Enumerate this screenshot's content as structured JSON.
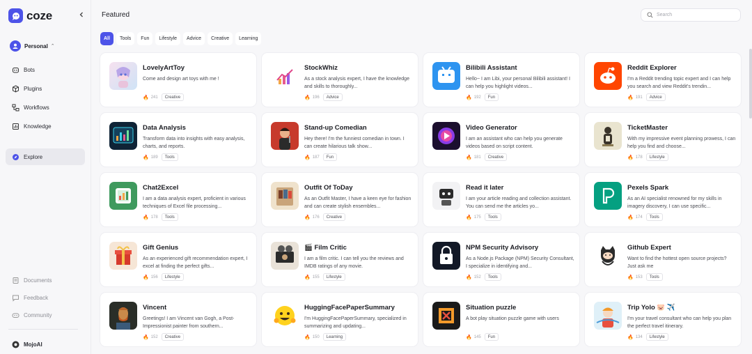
{
  "app": {
    "name": "coze"
  },
  "sidebar": {
    "workspace": "Personal",
    "nav": [
      {
        "label": "Bots",
        "icon": "bot-icon"
      },
      {
        "label": "Plugins",
        "icon": "plugin-icon"
      },
      {
        "label": "Workflows",
        "icon": "workflow-icon"
      },
      {
        "label": "Knowledge",
        "icon": "knowledge-icon"
      },
      {
        "label": "Explore",
        "icon": "explore-icon"
      }
    ],
    "bottom": [
      {
        "label": "Documents",
        "icon": "document-icon"
      },
      {
        "label": "Feedback",
        "icon": "feedback-icon"
      },
      {
        "label": "Community",
        "icon": "community-icon"
      }
    ],
    "user": "MojoAI"
  },
  "header": {
    "title": "Featured",
    "search_placeholder": "Search"
  },
  "filters": [
    "All",
    "Tools",
    "Fun",
    "Lifestyle",
    "Advice",
    "Creative",
    "Learning"
  ],
  "bots": [
    {
      "name": "LovelyArtToy",
      "desc": "Come and design art toys with me !",
      "count": "241",
      "tag": "Creative"
    },
    {
      "name": "StockWhiz",
      "desc": "As a stock analysis expert, I have the knowledge and skills to thoroughly...",
      "count": "196",
      "tag": "Advice"
    },
    {
      "name": "Bilibili Assistant",
      "desc": "Hello~ I am Libi, your personal Bilibili assistant! I can help you highlight videos...",
      "count": "192",
      "tag": "Fun"
    },
    {
      "name": "Reddit Explorer",
      "desc": "I'm a Reddit trending topic expert and I can help you search and view Reddit's trendin...",
      "count": "191",
      "tag": "Advice"
    },
    {
      "name": "Data Analysis",
      "desc": "Transform data into insights with easy analysis, charts, and reports.",
      "count": "189",
      "tag": "Tools"
    },
    {
      "name": "Stand-up Comedian",
      "desc": "Hey there! I'm the funniest comedian in town. I can create hilarious talk show...",
      "count": "187",
      "tag": "Fun"
    },
    {
      "name": "Video Generator",
      "desc": "I am an assistant who can help you generate videos based on script content.",
      "count": "181",
      "tag": "Creative"
    },
    {
      "name": "TicketMaster",
      "desc": "With my impressive event planning prowess, I can help you find and choose...",
      "count": "178",
      "tag": "Lifestyle"
    },
    {
      "name": "Chat2Excel",
      "desc": "I am a data analysis expert, proficient in various techniques of Excel file processing...",
      "count": "178",
      "tag": "Tools"
    },
    {
      "name": "Outfit Of ToDay",
      "desc": "As an Outfit Master, I have a keen eye for fashion and can create stylish ensembles...",
      "count": "176",
      "tag": "Creative"
    },
    {
      "name": "Read it later",
      "desc": "I am your article reading and collection assistant. You can send me the articles yo...",
      "count": "175",
      "tag": "Tools"
    },
    {
      "name": "Pexels Spark",
      "desc": "As an AI specialist renowned for my skills in imagery discovery, I can use specific...",
      "count": "174",
      "tag": "Tools"
    },
    {
      "name": "Gift Genius",
      "desc": "As an experienced gift recommendation expert, I excel at finding the perfect gifts...",
      "count": "156",
      "tag": "Lifestyle"
    },
    {
      "name": "🎬 Film Critic",
      "desc": "I am a film critic. I can tell you the reviews and IMDB ratings of any movie.",
      "count": "155",
      "tag": "Lifestyle"
    },
    {
      "name": "NPM Security Advisory",
      "desc": "As a Node.js Package (NPM) Security Consultant, I specialize in identifying and...",
      "count": "152",
      "tag": "Tools"
    },
    {
      "name": "Github Expert",
      "desc": "Want to find the hottest open source projects? Just ask me",
      "count": "153",
      "tag": "Tools"
    },
    {
      "name": "Vincent",
      "desc": "Greetings! I am Vincent van Gogh, a Post-Impressionist painter from southern...",
      "count": "152",
      "tag": "Creative"
    },
    {
      "name": "HuggingFacePaperSummary",
      "desc": "I'm HuggingFacePaperSummary, specialized in summarizing and updating...",
      "count": "150",
      "tag": "Learning"
    },
    {
      "name": "Situation puzzle",
      "desc": "A bot play situation puzzle game with users",
      "count": "145",
      "tag": "Fun"
    },
    {
      "name": "Trip Yolo 🐷 ✈️",
      "desc": "I'm your travel consultant who can help you plan the perfect travel itinerary.",
      "count": "134",
      "tag": "Lifestyle"
    }
  ]
}
